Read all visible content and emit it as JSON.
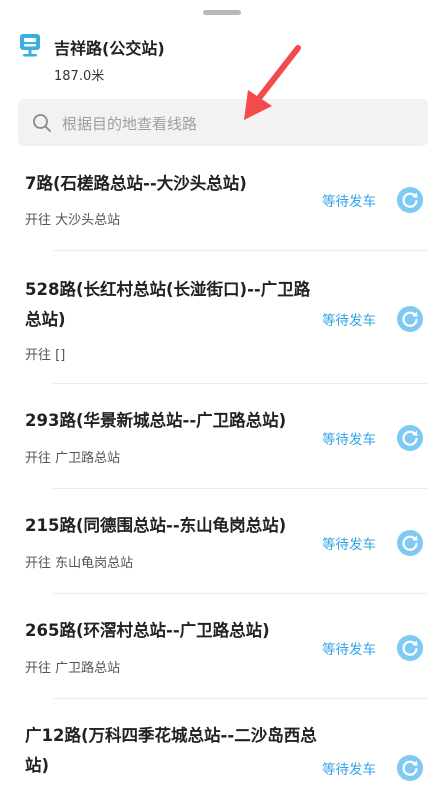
{
  "stop": {
    "name": "吉祥路(公交站)",
    "distance": "187.0米"
  },
  "search": {
    "placeholder": "根据目的地查看线路"
  },
  "routes": [
    {
      "title": "7路(石槎路总站--大沙头总站)",
      "dest": "开往 大沙头总站",
      "status": "等待发车"
    },
    {
      "title": "528路(长红村总站(长湴街口)--广卫路总站)",
      "dest": "开往 []",
      "status": "等待发车"
    },
    {
      "title": "293路(华景新城总站--广卫路总站)",
      "dest": "开往 广卫路总站",
      "status": "等待发车"
    },
    {
      "title": "215路(同德围总站--东山龟岗总站)",
      "dest": "开往 东山龟岗总站",
      "status": "等待发车"
    },
    {
      "title": "265路(环滘村总站--广卫路总站)",
      "dest": "开往 广卫路总站",
      "status": "等待发车"
    },
    {
      "title": "广12路(万科四季花城总站--二沙岛西总站)",
      "dest": "",
      "status": "等待发车"
    }
  ],
  "icons": {
    "stop": "bus-stop-icon",
    "search": "search-icon",
    "refresh": "refresh-icon",
    "annotation": "red-arrow-icon"
  },
  "colors": {
    "accent": "#33a7e6",
    "stop_icon": "#3aaee0",
    "arrow": "#f24b4b"
  }
}
